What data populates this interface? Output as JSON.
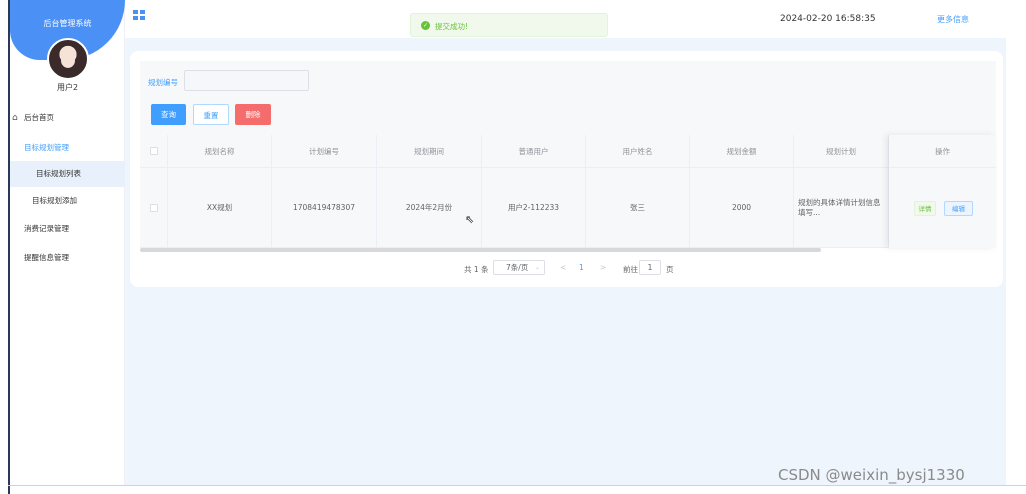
{
  "sidebar": {
    "system_title": "后台管理系统",
    "user_name": "用户2",
    "items": [
      {
        "label": "后台首页"
      },
      {
        "label": "目标规划管理"
      },
      {
        "label": "目标规划列表"
      },
      {
        "label": "目标规划添加"
      },
      {
        "label": "消费记录管理"
      },
      {
        "label": "提醒信息管理"
      }
    ]
  },
  "topbar": {
    "datetime": "2024-02-20 16:58:35",
    "more_info": "更多信息"
  },
  "toast": {
    "message": "提交成功!"
  },
  "filter": {
    "label": "规划编号",
    "value": "",
    "query_button": "查询",
    "reset_button": "重置",
    "delete_button": "删除"
  },
  "table": {
    "headers": [
      "规划名称",
      "计划编号",
      "规划期间",
      "普通用户",
      "用户姓名",
      "规划金额",
      "规划计划",
      "操作"
    ],
    "rows": [
      {
        "name": "XX规划",
        "plan_no": "1708419478307",
        "period": "2024年2月份",
        "user": "用户2-112233",
        "user_name": "张三",
        "amount": "2000",
        "plan": "规划的具体详情计划信息填写..."
      }
    ],
    "detail_button": "详情",
    "edit_button": "编辑"
  },
  "pagination": {
    "total": "共 1 条",
    "page_size": "7条/页",
    "prev": "<",
    "current_page": "1",
    "next": ">",
    "goto_label": "前往",
    "goto_value": "1",
    "page_label": "页"
  },
  "watermark": "CSDN @weixin_bysj1330",
  "colors": {
    "primary": "#409eff",
    "success": "#67c23a",
    "danger": "#f56c6c",
    "sidebar_head": "#4a90f5"
  }
}
